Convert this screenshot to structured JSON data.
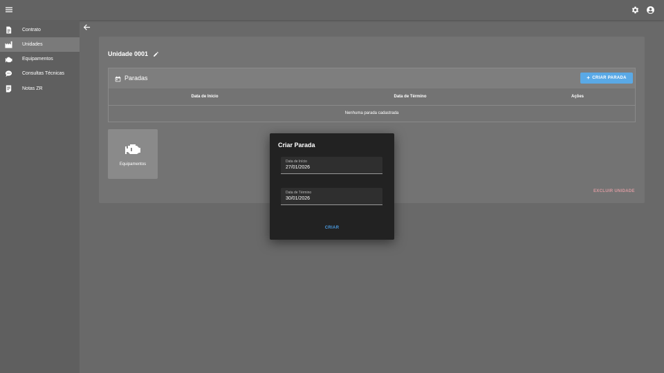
{
  "topbar": {
    "menu_icon": "menu-icon",
    "settings_icon": "gear-icon",
    "account_icon": "account-circle-icon"
  },
  "sidebar": {
    "items": [
      {
        "label": "Contrato",
        "icon": "file-document-icon"
      },
      {
        "label": "Unidades",
        "icon": "factory-icon",
        "active": true
      },
      {
        "label": "Equipamentos",
        "icon": "engine-icon"
      },
      {
        "label": "Consultas Técnicas",
        "icon": "chat-icon"
      },
      {
        "label": "Notas ZR",
        "icon": "notes-icon"
      }
    ]
  },
  "main": {
    "unit_title": "Unidade 0001",
    "paradas": {
      "title": "Paradas",
      "add_button": "CRIAR PARADA",
      "columns": [
        "Data de Início",
        "Data de Término",
        "Ações"
      ],
      "empty_text": "Nenhuma parada cadastrada"
    },
    "equipment_card": {
      "label": "Equipamentos"
    },
    "delete_button": "EXCLUIR UNIDADE"
  },
  "dialog": {
    "title": "Criar Parada",
    "fields": [
      {
        "label": "Data de Início",
        "value": "27/01/2026"
      },
      {
        "label": "Data de Término",
        "value": "30/01/2026"
      }
    ],
    "submit": "CRIAR"
  },
  "colors": {
    "accent": "#5aa9e6",
    "danger": "#d99aa0",
    "dialog_bg": "#222222"
  }
}
